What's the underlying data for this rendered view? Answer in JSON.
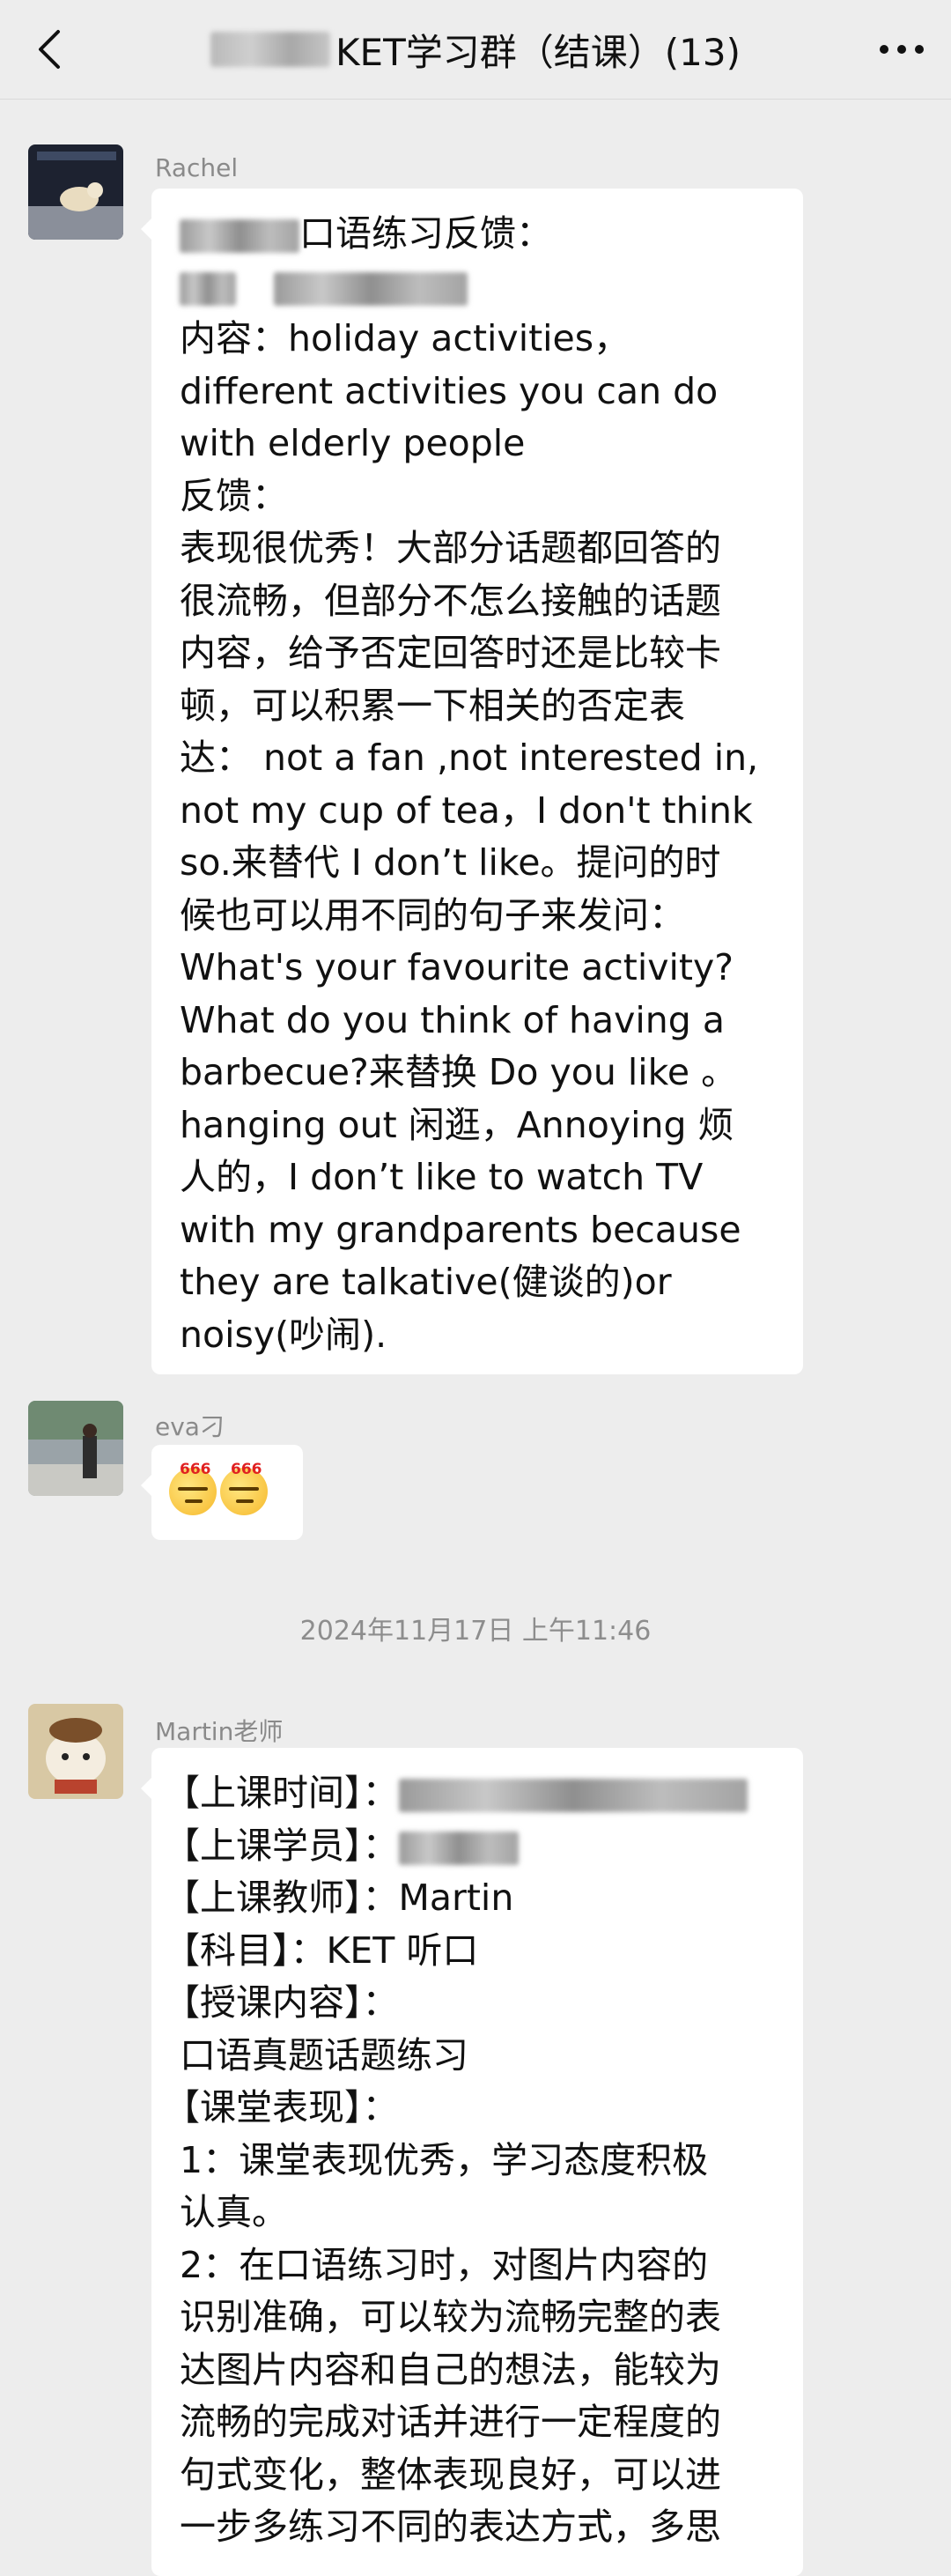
{
  "header": {
    "title": "KET学习群（结课）(13)",
    "back_icon": "chevron-left-icon",
    "more_icon": "more-dots-icon"
  },
  "messages": [
    {
      "sender": "Rachel",
      "lines": [
        "口语练习反馈：",
        "",
        "内容：holiday activities，",
        "different activities you can do",
        "with elderly people",
        "反馈：",
        "表现很优秀！大部分话题都回答的",
        "很流畅，但部分不怎么接触的话题",
        "内容，给予否定回答时还是比较卡",
        "顿，可以积累一下相关的否定表",
        "达： not a fan ,not interested in,",
        "not my cup of tea，I don't think",
        "so.来替代 I don’t like。提问的时",
        "候也可以用不同的句子来发问：",
        "What's your favourite activity?",
        "What do you think of having a",
        "barbecue?来替换 Do you like 。",
        "hanging out 闲逛，Annoying 烦",
        "人的，I don’t like to watch TV",
        "with my grandparents because",
        "they are talkative(健谈的)or",
        "noisy(吵闹)."
      ]
    },
    {
      "sender": "eva刁",
      "emoji_label": "666"
    },
    {
      "timestamp": "2024年11月17日 上午11:46"
    },
    {
      "sender": "Martin老师",
      "lines": [
        "【上课时间】：",
        "【上课学员】：",
        "【上课教师】：Martin",
        "【科目】：KET 听口",
        "【授课内容】：",
        "口语真题话题练习",
        "【课堂表现】：",
        "1：课堂表现优秀，学习态度积极",
        "认真。",
        "2：在口语练习时，对图片内容的",
        "识别准确，可以较为流畅完整的表",
        "达图片内容和自己的想法，能较为",
        "流畅的完成对话并进行一定程度的",
        "句式变化，整体表现良好，可以进",
        "一步多练习不同的表达方式，多思"
      ]
    }
  ]
}
